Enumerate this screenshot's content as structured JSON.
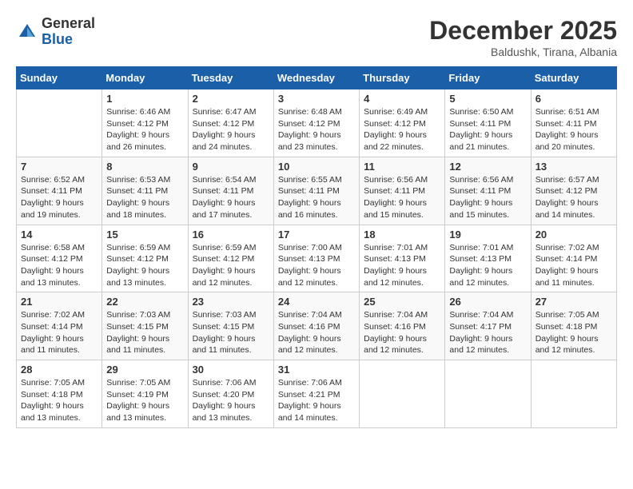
{
  "logo": {
    "general": "General",
    "blue": "Blue"
  },
  "header": {
    "month": "December 2025",
    "location": "Baldushk, Tirana, Albania"
  },
  "days_of_week": [
    "Sunday",
    "Monday",
    "Tuesday",
    "Wednesday",
    "Thursday",
    "Friday",
    "Saturday"
  ],
  "weeks": [
    [
      {
        "day": "",
        "sunrise": "",
        "sunset": "",
        "daylight": ""
      },
      {
        "day": "1",
        "sunrise": "Sunrise: 6:46 AM",
        "sunset": "Sunset: 4:12 PM",
        "daylight": "Daylight: 9 hours and 26 minutes."
      },
      {
        "day": "2",
        "sunrise": "Sunrise: 6:47 AM",
        "sunset": "Sunset: 4:12 PM",
        "daylight": "Daylight: 9 hours and 24 minutes."
      },
      {
        "day": "3",
        "sunrise": "Sunrise: 6:48 AM",
        "sunset": "Sunset: 4:12 PM",
        "daylight": "Daylight: 9 hours and 23 minutes."
      },
      {
        "day": "4",
        "sunrise": "Sunrise: 6:49 AM",
        "sunset": "Sunset: 4:12 PM",
        "daylight": "Daylight: 9 hours and 22 minutes."
      },
      {
        "day": "5",
        "sunrise": "Sunrise: 6:50 AM",
        "sunset": "Sunset: 4:11 PM",
        "daylight": "Daylight: 9 hours and 21 minutes."
      },
      {
        "day": "6",
        "sunrise": "Sunrise: 6:51 AM",
        "sunset": "Sunset: 4:11 PM",
        "daylight": "Daylight: 9 hours and 20 minutes."
      }
    ],
    [
      {
        "day": "7",
        "sunrise": "Sunrise: 6:52 AM",
        "sunset": "Sunset: 4:11 PM",
        "daylight": "Daylight: 9 hours and 19 minutes."
      },
      {
        "day": "8",
        "sunrise": "Sunrise: 6:53 AM",
        "sunset": "Sunset: 4:11 PM",
        "daylight": "Daylight: 9 hours and 18 minutes."
      },
      {
        "day": "9",
        "sunrise": "Sunrise: 6:54 AM",
        "sunset": "Sunset: 4:11 PM",
        "daylight": "Daylight: 9 hours and 17 minutes."
      },
      {
        "day": "10",
        "sunrise": "Sunrise: 6:55 AM",
        "sunset": "Sunset: 4:11 PM",
        "daylight": "Daylight: 9 hours and 16 minutes."
      },
      {
        "day": "11",
        "sunrise": "Sunrise: 6:56 AM",
        "sunset": "Sunset: 4:11 PM",
        "daylight": "Daylight: 9 hours and 15 minutes."
      },
      {
        "day": "12",
        "sunrise": "Sunrise: 6:56 AM",
        "sunset": "Sunset: 4:11 PM",
        "daylight": "Daylight: 9 hours and 15 minutes."
      },
      {
        "day": "13",
        "sunrise": "Sunrise: 6:57 AM",
        "sunset": "Sunset: 4:12 PM",
        "daylight": "Daylight: 9 hours and 14 minutes."
      }
    ],
    [
      {
        "day": "14",
        "sunrise": "Sunrise: 6:58 AM",
        "sunset": "Sunset: 4:12 PM",
        "daylight": "Daylight: 9 hours and 13 minutes."
      },
      {
        "day": "15",
        "sunrise": "Sunrise: 6:59 AM",
        "sunset": "Sunset: 4:12 PM",
        "daylight": "Daylight: 9 hours and 13 minutes."
      },
      {
        "day": "16",
        "sunrise": "Sunrise: 6:59 AM",
        "sunset": "Sunset: 4:12 PM",
        "daylight": "Daylight: 9 hours and 12 minutes."
      },
      {
        "day": "17",
        "sunrise": "Sunrise: 7:00 AM",
        "sunset": "Sunset: 4:13 PM",
        "daylight": "Daylight: 9 hours and 12 minutes."
      },
      {
        "day": "18",
        "sunrise": "Sunrise: 7:01 AM",
        "sunset": "Sunset: 4:13 PM",
        "daylight": "Daylight: 9 hours and 12 minutes."
      },
      {
        "day": "19",
        "sunrise": "Sunrise: 7:01 AM",
        "sunset": "Sunset: 4:13 PM",
        "daylight": "Daylight: 9 hours and 12 minutes."
      },
      {
        "day": "20",
        "sunrise": "Sunrise: 7:02 AM",
        "sunset": "Sunset: 4:14 PM",
        "daylight": "Daylight: 9 hours and 11 minutes."
      }
    ],
    [
      {
        "day": "21",
        "sunrise": "Sunrise: 7:02 AM",
        "sunset": "Sunset: 4:14 PM",
        "daylight": "Daylight: 9 hours and 11 minutes."
      },
      {
        "day": "22",
        "sunrise": "Sunrise: 7:03 AM",
        "sunset": "Sunset: 4:15 PM",
        "daylight": "Daylight: 9 hours and 11 minutes."
      },
      {
        "day": "23",
        "sunrise": "Sunrise: 7:03 AM",
        "sunset": "Sunset: 4:15 PM",
        "daylight": "Daylight: 9 hours and 11 minutes."
      },
      {
        "day": "24",
        "sunrise": "Sunrise: 7:04 AM",
        "sunset": "Sunset: 4:16 PM",
        "daylight": "Daylight: 9 hours and 12 minutes."
      },
      {
        "day": "25",
        "sunrise": "Sunrise: 7:04 AM",
        "sunset": "Sunset: 4:16 PM",
        "daylight": "Daylight: 9 hours and 12 minutes."
      },
      {
        "day": "26",
        "sunrise": "Sunrise: 7:04 AM",
        "sunset": "Sunset: 4:17 PM",
        "daylight": "Daylight: 9 hours and 12 minutes."
      },
      {
        "day": "27",
        "sunrise": "Sunrise: 7:05 AM",
        "sunset": "Sunset: 4:18 PM",
        "daylight": "Daylight: 9 hours and 12 minutes."
      }
    ],
    [
      {
        "day": "28",
        "sunrise": "Sunrise: 7:05 AM",
        "sunset": "Sunset: 4:18 PM",
        "daylight": "Daylight: 9 hours and 13 minutes."
      },
      {
        "day": "29",
        "sunrise": "Sunrise: 7:05 AM",
        "sunset": "Sunset: 4:19 PM",
        "daylight": "Daylight: 9 hours and 13 minutes."
      },
      {
        "day": "30",
        "sunrise": "Sunrise: 7:06 AM",
        "sunset": "Sunset: 4:20 PM",
        "daylight": "Daylight: 9 hours and 13 minutes."
      },
      {
        "day": "31",
        "sunrise": "Sunrise: 7:06 AM",
        "sunset": "Sunset: 4:21 PM",
        "daylight": "Daylight: 9 hours and 14 minutes."
      },
      {
        "day": "",
        "sunrise": "",
        "sunset": "",
        "daylight": ""
      },
      {
        "day": "",
        "sunrise": "",
        "sunset": "",
        "daylight": ""
      },
      {
        "day": "",
        "sunrise": "",
        "sunset": "",
        "daylight": ""
      }
    ]
  ]
}
